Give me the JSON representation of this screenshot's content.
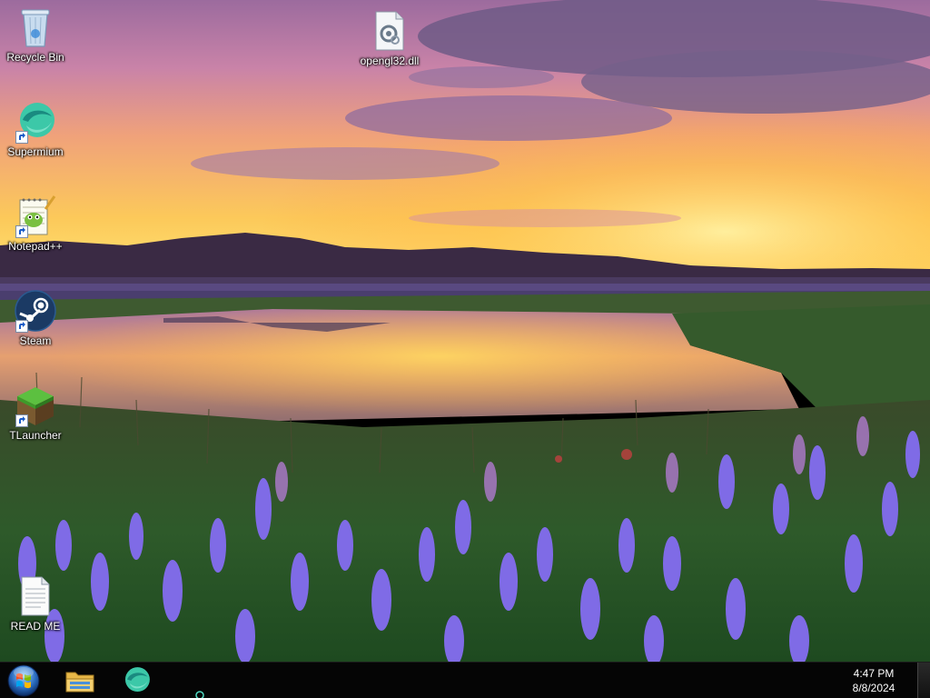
{
  "desktop": {
    "icons": [
      {
        "id": "recycle-bin",
        "label": "Recycle Bin",
        "icon": "recycle-bin-icon",
        "shortcut": false
      },
      {
        "id": "opengl32",
        "label": "opengl32.dll",
        "icon": "dll-file-icon",
        "shortcut": false
      },
      {
        "id": "supermium",
        "label": "Supermium",
        "icon": "supermium-icon",
        "shortcut": true
      },
      {
        "id": "notepadpp",
        "label": "Notepad++",
        "icon": "notepadpp-icon",
        "shortcut": true
      },
      {
        "id": "steam",
        "label": "Steam",
        "icon": "steam-icon",
        "shortcut": true
      },
      {
        "id": "tlauncher",
        "label": "TLauncher",
        "icon": "tlauncher-icon",
        "shortcut": true
      },
      {
        "id": "readme",
        "label": "READ ME",
        "icon": "text-file-icon",
        "shortcut": false
      }
    ]
  },
  "taskbar": {
    "start": {
      "icon": "windows-start-orb-icon"
    },
    "pinned": [
      {
        "id": "explorer",
        "icon": "file-explorer-icon"
      },
      {
        "id": "supermium",
        "icon": "supermium-icon"
      }
    ],
    "clock": {
      "time": "4:47 PM",
      "date": "8/8/2024"
    }
  },
  "colors": {
    "taskbar_bg": "#050505",
    "sky_top": "#a46aa3",
    "sky_horizon": "#ffd84a",
    "flowers": "#7b6be0"
  }
}
